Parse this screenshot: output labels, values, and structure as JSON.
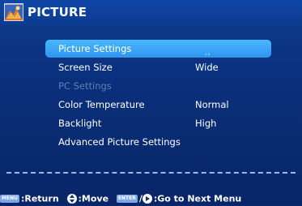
{
  "header": {
    "title": "PICTURE",
    "logo_icon": "picture-menu-icon"
  },
  "menu": {
    "items": [
      {
        "label": "Picture Settings",
        "value": "",
        "state": "selected",
        "has_submenu": true
      },
      {
        "label": "Screen Size",
        "value": "Wide",
        "state": "normal"
      },
      {
        "label": "PC Settings",
        "value": "",
        "state": "disabled"
      },
      {
        "label": "Color Temperature",
        "value": "Normal",
        "state": "normal"
      },
      {
        "label": "Backlight",
        "value": "High",
        "state": "normal"
      },
      {
        "label": "Advanced Picture Settings",
        "value": "",
        "state": "normal"
      }
    ],
    "submenu_indicator": "››"
  },
  "footer": {
    "menu_key_label": "MENU",
    "return_text": ":Return",
    "move_icon": "up-down-arrows-icon",
    "move_text": ":Move",
    "enter_key_label": "ENTER",
    "next_icon": "right-arrow-button-icon",
    "next_text": ":Go to Next Menu"
  },
  "colors": {
    "background": "#0a2f7a",
    "selected_highlight": "#3ea6f7",
    "disabled_text": "#5f7fb6",
    "divider": "#9fb6e6"
  }
}
